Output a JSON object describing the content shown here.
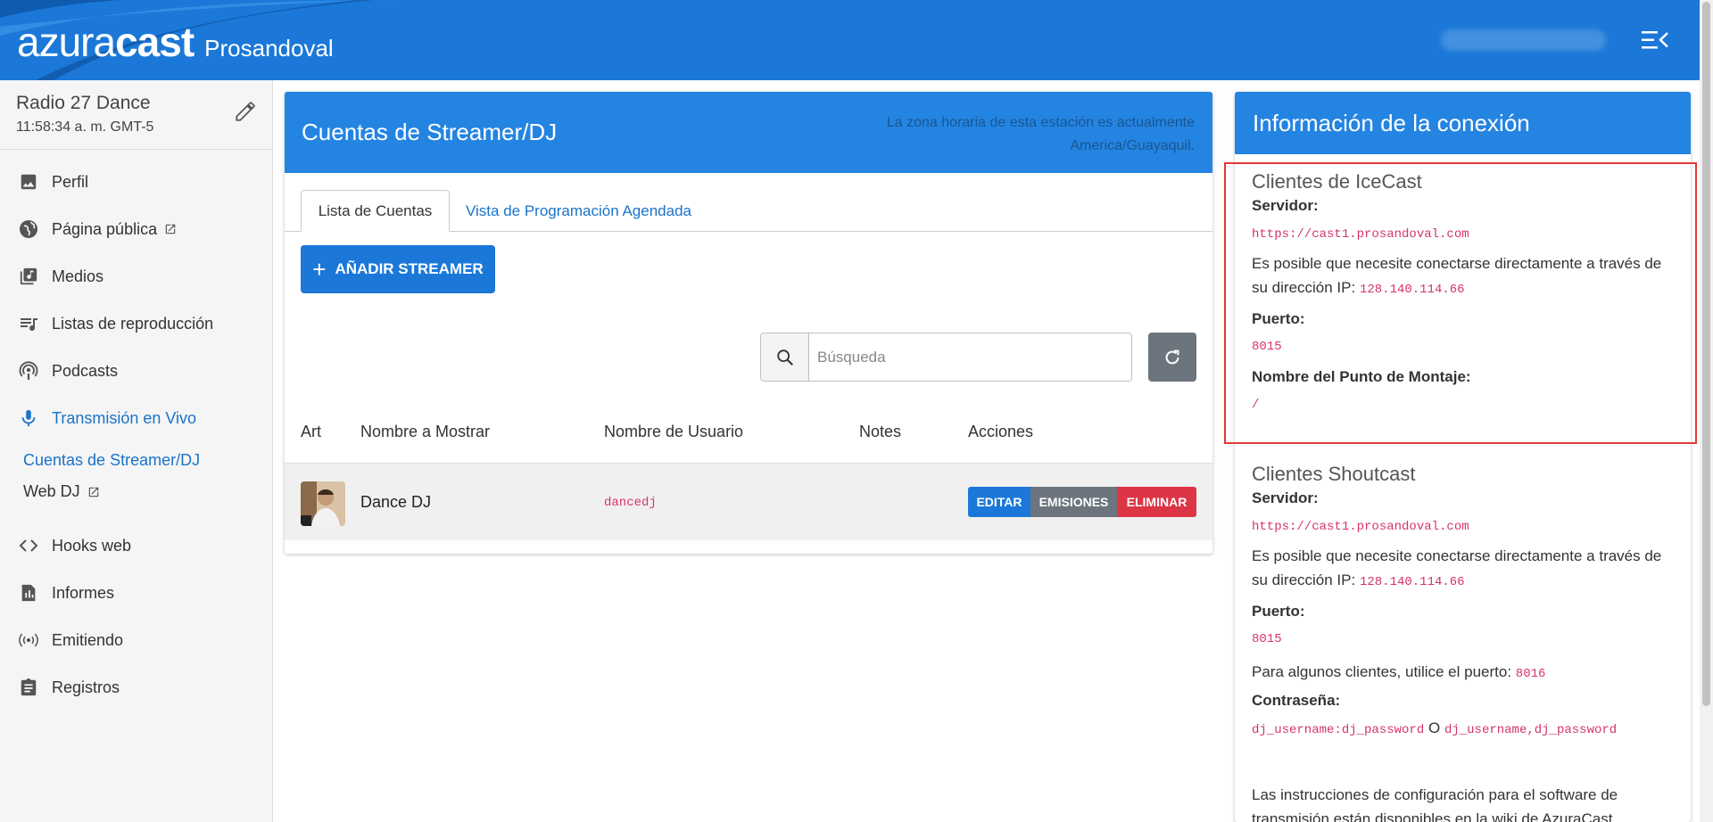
{
  "header": {
    "logo_bold": "azura",
    "logo_light": "cast",
    "station_short": "Prosandoval"
  },
  "sidebar": {
    "station_name": "Radio 27 Dance",
    "station_time": "11:58:34 a. m. GMT-5",
    "items": [
      {
        "label": "Perfil",
        "icon": "image-icon"
      },
      {
        "label": "Página pública",
        "icon": "globe-icon"
      },
      {
        "label": "Medios",
        "icon": "music-library-icon"
      },
      {
        "label": "Listas de reproducción",
        "icon": "playlist-icon"
      },
      {
        "label": "Podcasts",
        "icon": "podcast-icon"
      },
      {
        "label": "Transmisión en Vivo",
        "icon": "mic-icon"
      },
      {
        "label": "Hooks web",
        "icon": "code-icon"
      },
      {
        "label": "Informes",
        "icon": "report-icon"
      },
      {
        "label": "Emitiendo",
        "icon": "broadcast-icon"
      },
      {
        "label": "Registros",
        "icon": "clipboard-icon"
      }
    ],
    "sub_items": [
      {
        "label": "Cuentas de Streamer/DJ"
      },
      {
        "label": "Web DJ"
      }
    ]
  },
  "main": {
    "title": "Cuentas de Streamer/DJ",
    "tz_line1": "La zona horaria de esta estación es actualmente",
    "tz_line2": "America/Guayaquil.",
    "tabs": [
      {
        "label": "Lista de Cuentas"
      },
      {
        "label": "Vista de Programación Agendada"
      }
    ],
    "add_label": "AÑADIR STREAMER",
    "search_placeholder": "Búsqueda",
    "columns": [
      "Art",
      "Nombre a Mostrar",
      "Nombre de Usuario",
      "Notes",
      "Acciones"
    ],
    "rows": [
      {
        "display_name": "Dance DJ",
        "username": "dancedj"
      }
    ],
    "actions": {
      "edit": "EDITAR",
      "broadcasts": "EMISIONES",
      "delete": "ELIMINAR"
    }
  },
  "connection": {
    "title": "Información de la conexión",
    "icecast": {
      "title": "Clientes de IceCast",
      "server_label": "Servidor:",
      "server": "https://cast1.prosandoval.com",
      "ip_text": "Es posible que necesite conectarse directamente a través de su dirección IP:",
      "ip": "128.140.114.66",
      "port_label": "Puerto:",
      "port": "8015",
      "mount_label": "Nombre del Punto de Montaje:",
      "mount": "/"
    },
    "shoutcast": {
      "title": "Clientes Shoutcast",
      "server_label": "Servidor:",
      "server": "https://cast1.prosandoval.com",
      "ip_text": "Es posible que necesite conectarse directamente a través de su dirección IP:",
      "ip": "128.140.114.66",
      "port_label": "Puerto:",
      "port": "8015",
      "alt_port_text": "Para algunos clientes, utilice el puerto:",
      "alt_port": "8016",
      "password_label": "Contraseña:",
      "password_fmt1": "dj_username:dj_password",
      "password_or": "O",
      "password_fmt2": "dj_username,dj_password",
      "instructions": "Las instrucciones de configuración para el software de transmisión están disponibles en la wiki de AzuraCast."
    }
  },
  "colors": {
    "brand": "#1b78d8",
    "card_header": "#2484e2",
    "code": "#d6336c",
    "danger": "#dc3545",
    "secondary": "#6c757d"
  }
}
